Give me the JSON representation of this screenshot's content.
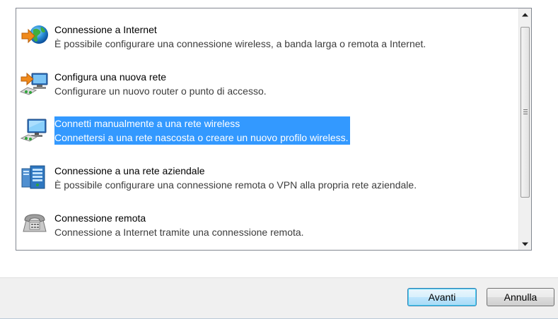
{
  "connection_options": [
    {
      "title": "Connessione a Internet",
      "description": "È possibile configurare una connessione wireless, a banda larga o remota a Internet.",
      "icon": "globe-arrow-icon"
    },
    {
      "title": "Configura una nuova rete",
      "description": "Configurare un nuovo router o punto di accesso.",
      "icon": "network-arrow-icon"
    },
    {
      "title": "Connetti manualmente a una rete wireless",
      "description": "Connettersi a una rete nascosta o creare un nuovo profilo wireless.",
      "icon": "wireless-computer-icon",
      "selected": true
    },
    {
      "title": "Connessione a una rete aziendale",
      "description": "È possibile configurare una connessione remota o VPN alla propria rete aziendale.",
      "icon": "workplace-server-icon"
    },
    {
      "title": "Connessione remota",
      "description": "Connessione a Internet tramite una connessione remota.",
      "icon": "dialup-phone-icon"
    }
  ],
  "buttons": {
    "next_label": "Avanti",
    "cancel_label": "Annulla"
  },
  "colors": {
    "selection": "#3399ff",
    "window_background": "#f0f0f0"
  }
}
